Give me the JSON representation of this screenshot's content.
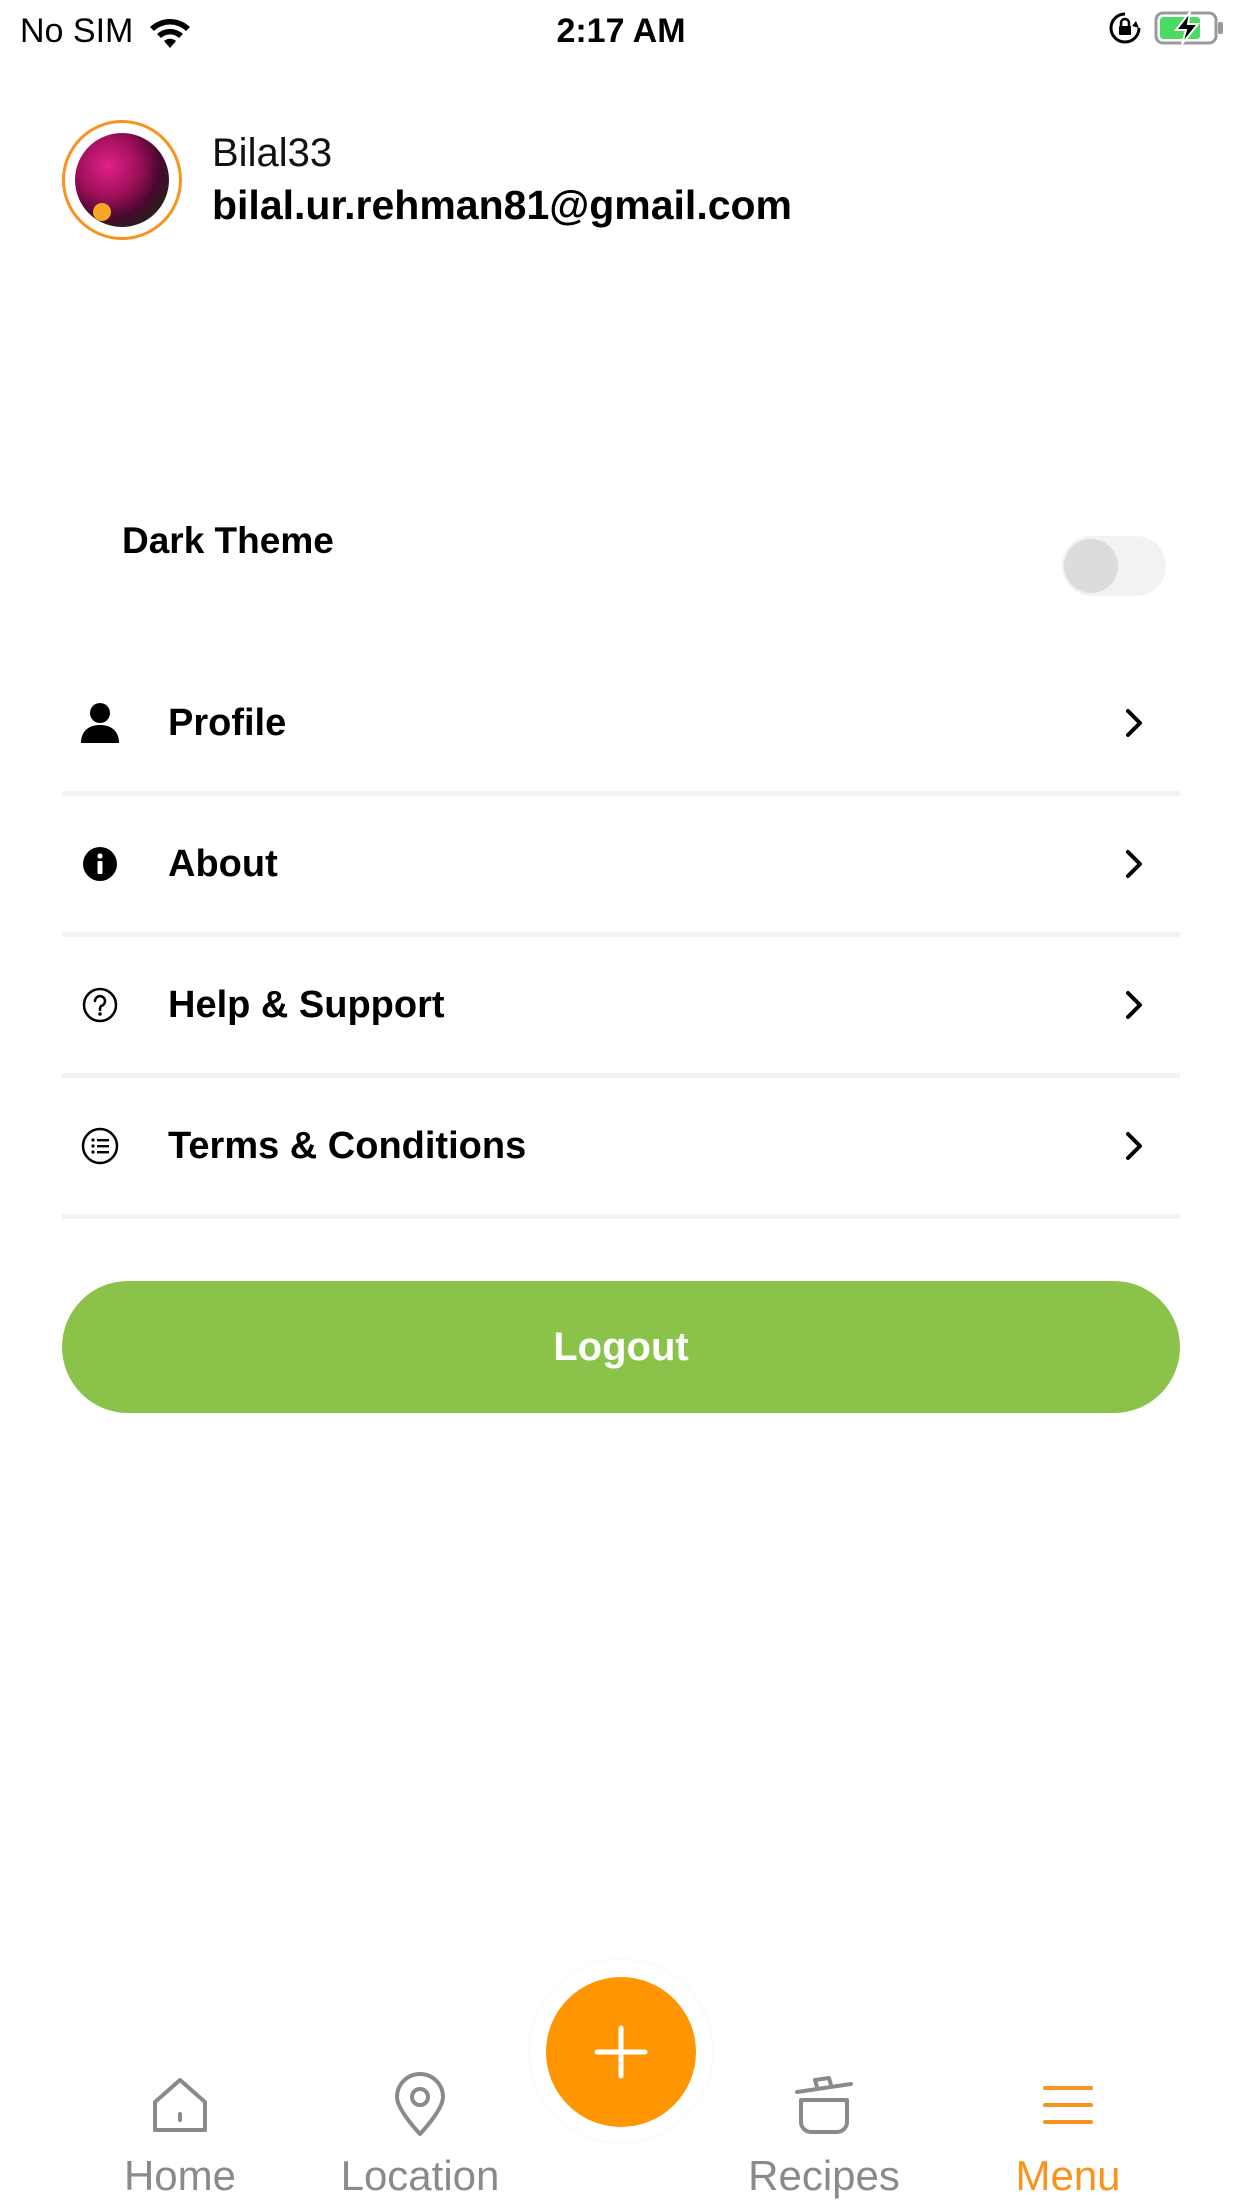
{
  "status_bar": {
    "carrier": "No SIM",
    "time": "2:17 AM"
  },
  "user": {
    "username": "Bilal33",
    "email": "bilal.ur.rehman81@gmail.com"
  },
  "settings": {
    "dark_theme_label": "Dark Theme",
    "dark_theme_enabled": false
  },
  "menu": {
    "items": [
      {
        "label": "Profile",
        "icon": "person-icon"
      },
      {
        "label": "About",
        "icon": "info-icon"
      },
      {
        "label": "Help & Support",
        "icon": "help-icon"
      },
      {
        "label": "Terms & Conditions",
        "icon": "list-icon"
      }
    ]
  },
  "logout_label": "Logout",
  "tabs": {
    "items": [
      {
        "label": "Home",
        "icon": "home-icon"
      },
      {
        "label": "Location",
        "icon": "location-pin-icon"
      },
      {
        "label": "Recipes",
        "icon": "pot-icon"
      },
      {
        "label": "Menu",
        "icon": "menu-icon"
      }
    ],
    "active": "Menu",
    "add_icon": "plus-icon"
  },
  "colors": {
    "accent": "#f7941d",
    "fab": "#ff9500",
    "logout": "#8bc34a",
    "tab_inactive": "#8a8a8a",
    "battery": "#4cd964"
  }
}
